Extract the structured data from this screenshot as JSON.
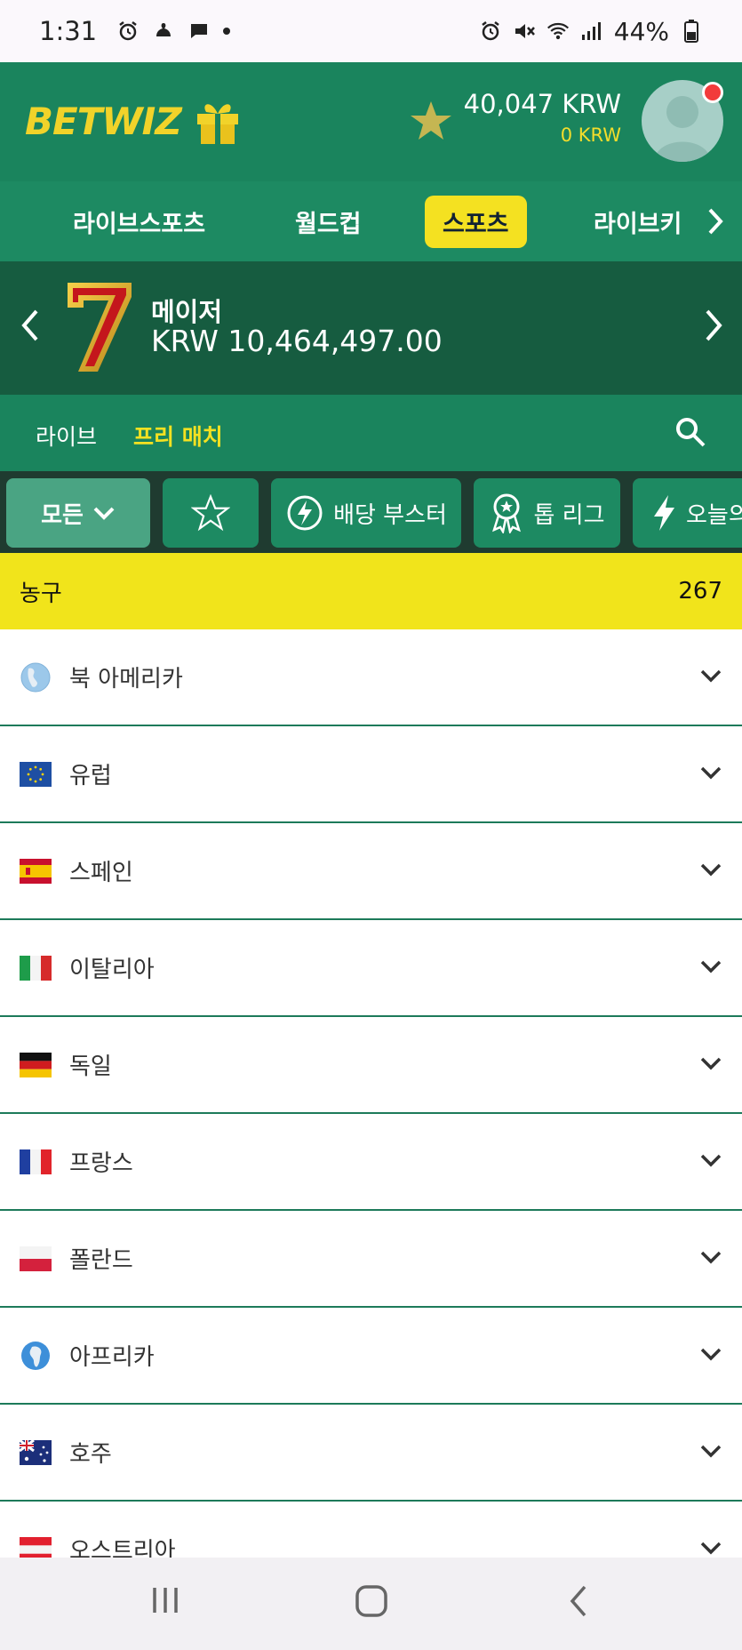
{
  "status_bar": {
    "time": "1:31",
    "battery": "44%",
    "left_icons": [
      "alarm-icon",
      "app-notification-icon",
      "message-icon",
      "more-dot-icon"
    ],
    "right_icons": [
      "alarm-icon",
      "mute-icon",
      "wifi-icon",
      "signal-icon",
      "battery-icon"
    ]
  },
  "header": {
    "logo_bet": "BET",
    "logo_wiz": "WIZ",
    "balance_main": "40,047 KRW",
    "balance_sub": "0 KRW",
    "accent": "#f4e121",
    "brand_green": "#1a845d"
  },
  "nav": {
    "items": [
      {
        "label": "라이브스포츠"
      },
      {
        "label": "월드컵"
      },
      {
        "label": "스포츠",
        "active": true
      },
      {
        "label": "라이브키"
      }
    ]
  },
  "jackpot": {
    "title": "메이저",
    "amount": "KRW 10,464,497.00"
  },
  "subtabs": {
    "live": "라이브",
    "prematch": "프리 매치"
  },
  "chips": {
    "all": "모든",
    "boost": "배당 부스터",
    "top_league": "톱 리그",
    "today": "오늘의"
  },
  "sport": {
    "name": "농구",
    "count": "267"
  },
  "regions": [
    {
      "label": "북 아메리카",
      "flag": "globe-americas"
    },
    {
      "label": "유럽",
      "flag": "eu-flag"
    },
    {
      "label": "스페인",
      "flag": "spain-flag"
    },
    {
      "label": "이탈리아",
      "flag": "italy-flag"
    },
    {
      "label": "독일",
      "flag": "germany-flag"
    },
    {
      "label": "프랑스",
      "flag": "france-flag"
    },
    {
      "label": "폴란드",
      "flag": "poland-flag"
    },
    {
      "label": "아프리카",
      "flag": "globe-africa"
    },
    {
      "label": "호주",
      "flag": "australia-flag"
    },
    {
      "label": "오스트리아",
      "flag": "austria-flag"
    }
  ]
}
